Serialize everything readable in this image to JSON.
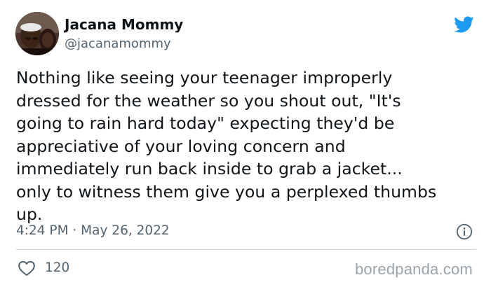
{
  "author": {
    "display_name": "Jacana Mommy",
    "handle": "@jacanamommy",
    "avatar_icon": "profile-photo"
  },
  "tweet": {
    "text_lines": [
      "Nothing like seeing your teenager improperly",
      "dressed for the weather so you shout out, \"It's",
      "going to rain hard today\" expecting they'd be",
      "appreciative of your loving concern and",
      "immediately run back inside to grab a jacket...",
      "only to witness them give you a perplexed thumbs",
      "up."
    ],
    "timestamp": "4:24 PM · May 26, 2022"
  },
  "engagement": {
    "like_icon": "heart-icon",
    "like_count": "120"
  },
  "brand": {
    "logo_icon": "twitter-bird-icon",
    "color": "#1d9bf0",
    "watermark": "boredpanda.com"
  },
  "colors": {
    "text": "#0f1419",
    "secondary": "#536471",
    "divider": "#cfd9de"
  }
}
